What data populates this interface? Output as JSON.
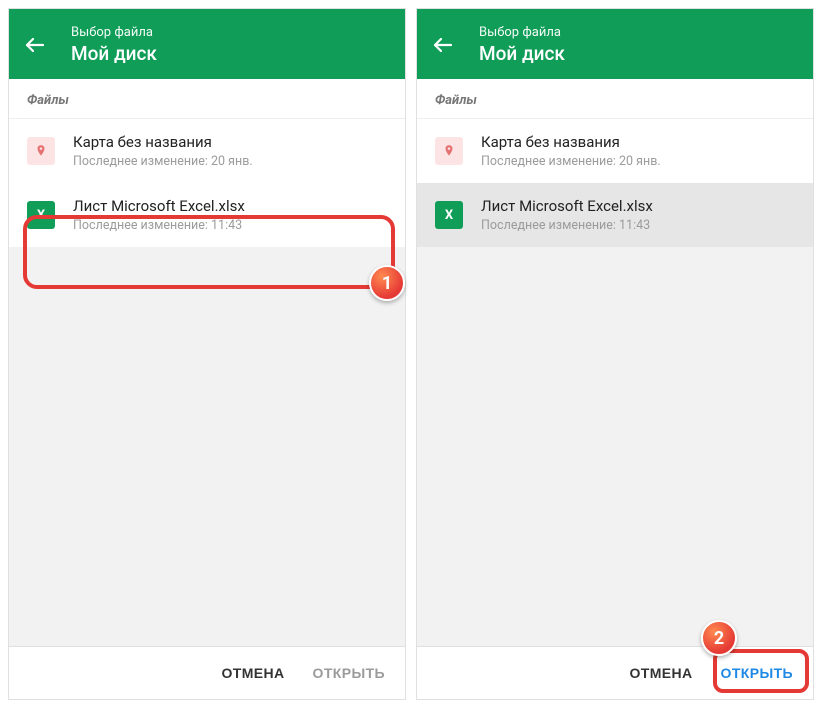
{
  "left": {
    "header": {
      "subtitle": "Выбор файла",
      "title": "Мой диск"
    },
    "section_label": "Файлы",
    "files": [
      {
        "name": "Карта без названия",
        "meta": "Последнее изменение: 20 янв."
      },
      {
        "name": "Лист Microsoft Excel.xlsx",
        "meta": "Последнее изменение: 11:43"
      }
    ],
    "footer": {
      "cancel": "ОТМЕНА",
      "open": "ОТКРЫТЬ"
    }
  },
  "right": {
    "header": {
      "subtitle": "Выбор файла",
      "title": "Мой диск"
    },
    "section_label": "Файлы",
    "files": [
      {
        "name": "Карта без названия",
        "meta": "Последнее изменение: 20 янв."
      },
      {
        "name": "Лист Microsoft Excel.xlsx",
        "meta": "Последнее изменение: 11:43"
      }
    ],
    "footer": {
      "cancel": "ОТМЕНА",
      "open": "ОТКРЫТЬ"
    }
  },
  "steps": {
    "one": "1",
    "two": "2"
  },
  "icons": {
    "excel_x": "X"
  }
}
